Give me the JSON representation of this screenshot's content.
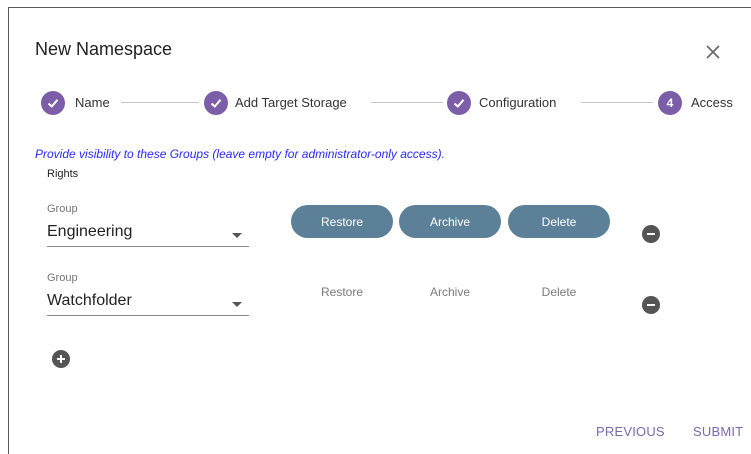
{
  "dialog": {
    "title": "New Namespace",
    "close_icon": "close-icon"
  },
  "stepper": {
    "accent": "#7b5ea7",
    "steps": [
      {
        "label": "Name",
        "state": "complete",
        "number": ""
      },
      {
        "label": "Add Target Storage",
        "state": "complete",
        "number": ""
      },
      {
        "label": "Configuration",
        "state": "complete",
        "number": ""
      },
      {
        "label": "Access",
        "state": "active",
        "number": "4"
      }
    ]
  },
  "access": {
    "hint": "Provide visibility to these Groups (leave empty for administrator-only access).",
    "rights_label": "Rights",
    "groups": [
      {
        "field_label": "Group",
        "value": "Engineering",
        "rights": [
          {
            "label": "Restore",
            "enabled": true
          },
          {
            "label": "Archive",
            "enabled": true
          },
          {
            "label": "Delete",
            "enabled": true
          }
        ]
      },
      {
        "field_label": "Group",
        "value": "Watchfolder",
        "rights": [
          {
            "label": "Restore",
            "enabled": false
          },
          {
            "label": "Archive",
            "enabled": false
          },
          {
            "label": "Delete",
            "enabled": false
          }
        ]
      }
    ],
    "remove_icon": "minus-circle-icon",
    "add_icon": "plus-circle-icon"
  },
  "footer": {
    "previous_label": "PREVIOUS",
    "submit_label": "SUBMIT"
  },
  "colors": {
    "pill_on": "#5b8098",
    "hint_text": "#2a2aff",
    "footer_text": "#7a6aae"
  }
}
